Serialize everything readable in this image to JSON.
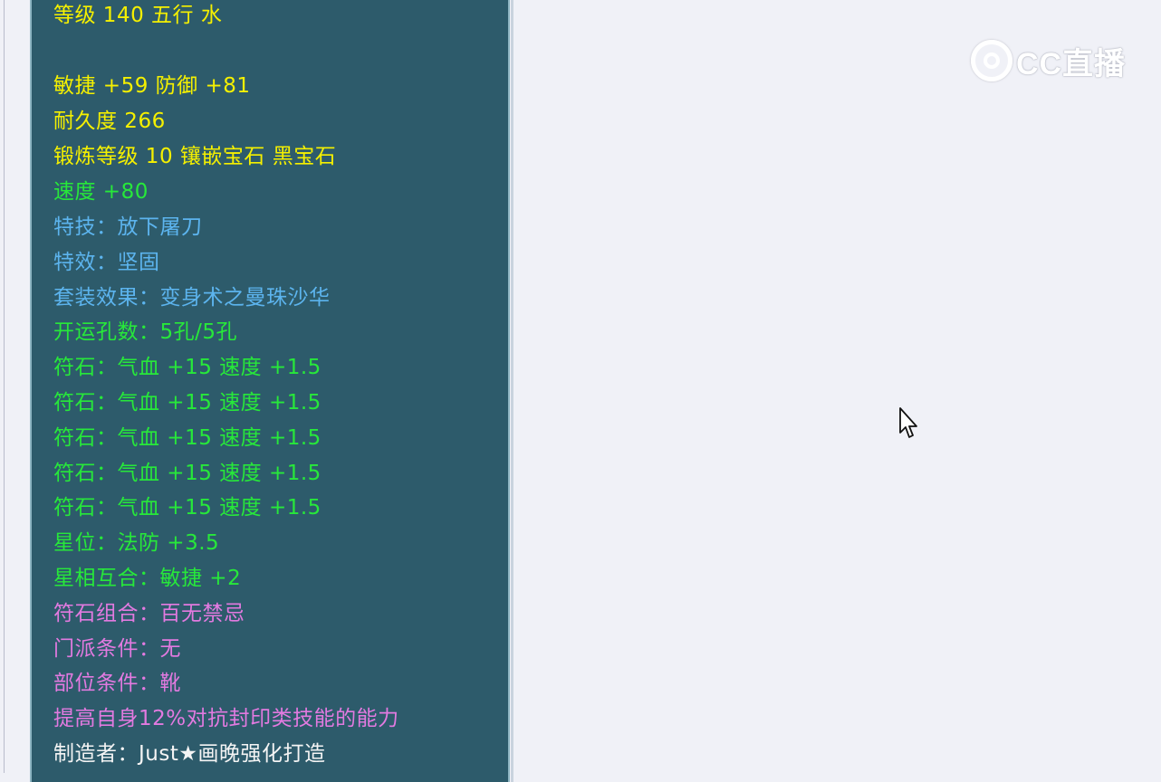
{
  "item_tooltip": {
    "lines": [
      {
        "text": "等级 140 五行 水",
        "color": "#f5f000"
      },
      {
        "text": "敏捷 +59 防御 +81",
        "color": "#f5f000"
      },
      {
        "text": "耐久度 266",
        "color": "#f5f000"
      },
      {
        "text": "锻炼等级 10 镶嵌宝石 黑宝石",
        "color": "#f5f000"
      },
      {
        "text": "速度 +80",
        "color": "#27e83a"
      },
      {
        "text": "特技：放下屠刀",
        "color": "#5cb4ee"
      },
      {
        "text": "特效：坚固",
        "color": "#5cb4ee"
      },
      {
        "text": "套装效果：变身术之曼珠沙华",
        "color": "#5cb4ee"
      },
      {
        "text": "开运孔数：5孔/5孔",
        "color": "#27e83a"
      },
      {
        "text": "符石：气血 +15 速度 +1.5",
        "color": "#27e83a"
      },
      {
        "text": "符石：气血 +15 速度 +1.5",
        "color": "#27e83a"
      },
      {
        "text": "符石：气血 +15 速度 +1.5",
        "color": "#27e83a"
      },
      {
        "text": "符石：气血 +15 速度 +1.5",
        "color": "#27e83a"
      },
      {
        "text": "符石：气血 +15 速度 +1.5",
        "color": "#27e83a"
      },
      {
        "text": "星位：法防 +3.5",
        "color": "#27e83a"
      },
      {
        "text": "星相互合：敏捷 +2",
        "color": "#27e83a"
      },
      {
        "text": "符石组合：百无禁忌",
        "color": "#e27ae0"
      },
      {
        "text": "门派条件：无",
        "color": "#e27ae0"
      },
      {
        "text": "部位条件：靴",
        "color": "#e27ae0"
      },
      {
        "text": "提高自身12%对抗封印类技能的能力",
        "color": "#e27ae0"
      },
      {
        "text": "制造者：Just★画晚强化打造",
        "color": "#f4f4f4"
      }
    ]
  },
  "watermark": {
    "text": "CC直播",
    "icon": "cc-logo-icon"
  },
  "cursor": {
    "icon": "mouse-pointer-icon"
  }
}
